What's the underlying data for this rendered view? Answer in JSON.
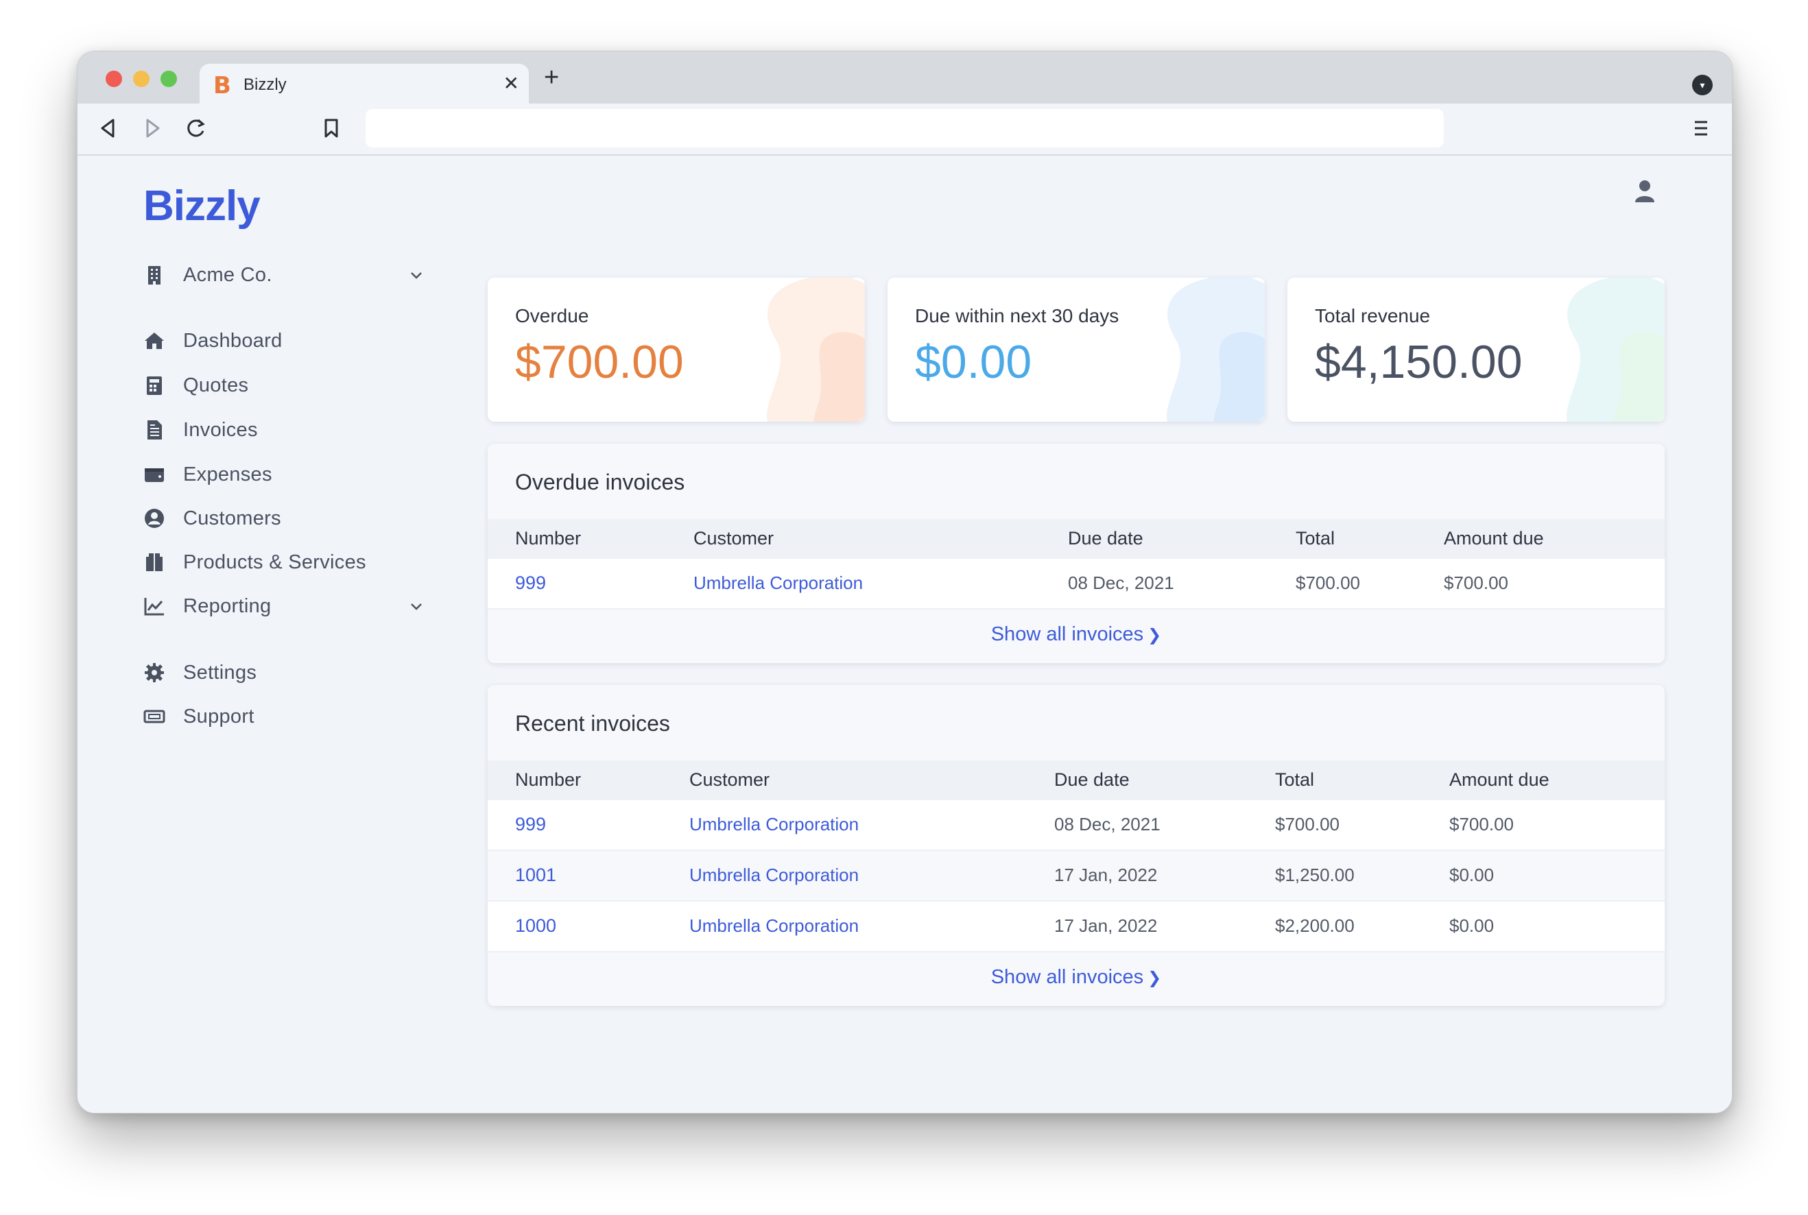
{
  "browser": {
    "tab_logo": "B",
    "tab_title": "Bizzly",
    "tab_close": "✕",
    "new_tab": "+",
    "address_value": ""
  },
  "app": {
    "brand": "Bizzly"
  },
  "sidebar": {
    "organization": "Acme Co.",
    "items": [
      {
        "label": "Dashboard",
        "icon": "home-icon"
      },
      {
        "label": "Quotes",
        "icon": "calculator-icon"
      },
      {
        "label": "Invoices",
        "icon": "file-invoice-icon"
      },
      {
        "label": "Expenses",
        "icon": "wallet-icon"
      },
      {
        "label": "Customers",
        "icon": "user-circle-icon"
      },
      {
        "label": "Products & Services",
        "icon": "box-icon"
      },
      {
        "label": "Reporting",
        "icon": "chart-line-icon"
      },
      {
        "label": "Settings",
        "icon": "gear-icon"
      },
      {
        "label": "Support",
        "icon": "ticket-icon"
      }
    ]
  },
  "stats": [
    {
      "label": "Overdue",
      "value": "$700.00",
      "color": "#e6803f"
    },
    {
      "label": "Due within next 30 days",
      "value": "$0.00",
      "color": "#4aa9e8"
    },
    {
      "label": "Total revenue",
      "value": "$4,150.00",
      "color": "#4a5263"
    }
  ],
  "overdue": {
    "title": "Overdue invoices",
    "columns": [
      "Number",
      "Customer",
      "Due date",
      "Total",
      "Amount due"
    ],
    "rows": [
      {
        "number": "999",
        "customer": "Umbrella Corporation",
        "due": "08 Dec, 2021",
        "total": "$700.00",
        "amount_due": "$700.00"
      }
    ],
    "show_all": "Show all invoices"
  },
  "recent": {
    "title": "Recent invoices",
    "columns": [
      "Number",
      "Customer",
      "Due date",
      "Total",
      "Amount due"
    ],
    "rows": [
      {
        "number": "999",
        "customer": "Umbrella Corporation",
        "due": "08 Dec, 2021",
        "total": "$700.00",
        "amount_due": "$700.00"
      },
      {
        "number": "1001",
        "customer": "Umbrella Corporation",
        "due": "17 Jan, 2022",
        "total": "$1,250.00",
        "amount_due": "$0.00"
      },
      {
        "number": "1000",
        "customer": "Umbrella Corporation",
        "due": "17 Jan, 2022",
        "total": "$2,200.00",
        "amount_due": "$0.00"
      }
    ],
    "show_all": "Show all invoices"
  }
}
